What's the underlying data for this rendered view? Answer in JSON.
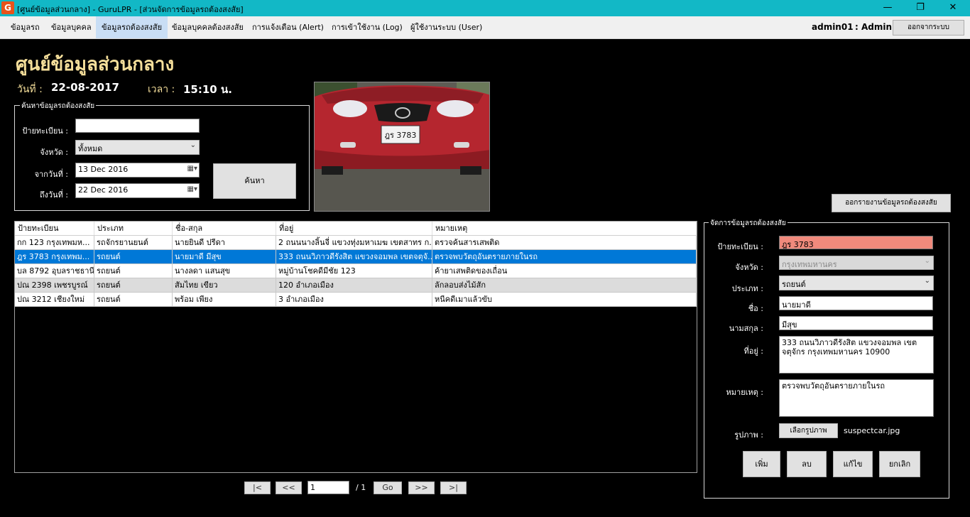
{
  "window": {
    "icon_text": "G",
    "title": "[ศูนย์ข้อมูลส่วนกลาง] - GuruLPR - [ส่วนจัดการข้อมูลรถต้องสงสัย]",
    "minimize": "—",
    "restore": "❐",
    "close": "✕"
  },
  "menu": {
    "items": [
      {
        "label": "ข้อมูลรถ"
      },
      {
        "label": "ข้อมูลบุคคล"
      },
      {
        "label": "ข้อมูลรถต้องสงสัย"
      },
      {
        "label": "ข้อมูลบุคคลต้องสงสัย"
      },
      {
        "label": "การแจ้งเตือน (Alert)"
      },
      {
        "label": "การเข้าใช้งาน (Log)"
      },
      {
        "label": "ผู้ใช้งานระบบ (User)"
      }
    ],
    "active_index": 2,
    "user": "admin01",
    "role": ": Admin",
    "logout": "ออกจากระบบ"
  },
  "header": {
    "title": "ศูนย์ข้อมูลส่วนกลาง",
    "date_label": "วันที่ :",
    "date_value": "22-08-2017",
    "time_label": "เวลา :",
    "time_value": "15:10 น."
  },
  "search": {
    "group_title": "ค้นหาข้อมูลรถต้องสงสัย",
    "plate_label": "ป้ายทะเบียน :",
    "plate_value": "",
    "province_label": "จังหวัด :",
    "province_value": "ทั้งหมด",
    "from_label": "จากวันที่ :",
    "from_value": "13 Dec 2016",
    "to_label": "ถึงวันที่ :",
    "to_value": "22 Dec 2016",
    "search_button": "ค้นหา"
  },
  "photo": {
    "plate_text": "ฎร 3783"
  },
  "report_button": "ออกรายงานข้อมูลรถต้องสงสัย",
  "table": {
    "columns": [
      "ป้ายทะเบียน",
      "ประเภท",
      "ชื่อ-สกุล",
      "ที่อยู่",
      "หมายเหตุ"
    ],
    "rows": [
      {
        "plate": "กก 123 กรุงเทพมห...",
        "type": "รถจักรยานยนต์",
        "name": "นายยินดี ปรีดา",
        "address": "2 ถนนนางลิ้นจี่ แขวงทุ่งมหาเมฆ เขตสาทร ก...",
        "note": "ตรวจค้นสารเสพติด"
      },
      {
        "plate": "ฎร 3783 กรุงเทพม...",
        "type": "รถยนต์",
        "name": "นายมาดี มีสุข",
        "address": "333 ถนนวิภาวดีรังสิต แขวงจอมพล เขตจตุจั...",
        "note": "ตรวจพบวัตถุอันตรายภายในรถ"
      },
      {
        "plate": "บล 8792 อุบลราชธานี",
        "type": "รถยนต์",
        "name": "นางลดา แสนสุข",
        "address": "หมู่บ้านโชคดีมีชัย 123",
        "note": "ค้ายาเสพติดของเถื่อน"
      },
      {
        "plate": "ปณ 2398 เพชรบูรณ์",
        "type": "รถยนต์",
        "name": "สัมไทย เขียว",
        "address": "120 อำเภอเมือง",
        "note": "ลักลอบส่งไม้สัก"
      },
      {
        "plate": "ปณ 3212 เชียงใหม่",
        "type": "รถยนต์",
        "name": "พร้อม เพียง",
        "address": "3 อำเภอเมือง",
        "note": "หนีคดีเมาแล้วขับ"
      }
    ],
    "selected_index": 1
  },
  "pager": {
    "first": "|<",
    "prev": "<<",
    "page_value": "1",
    "total": "/ 1",
    "go": "Go",
    "next": ">>",
    "last": ">|"
  },
  "manage": {
    "group_title": "จัดการข้อมูลรถต้องสงสัย",
    "plate_label": "ป้ายทะเบียน :",
    "plate_value": "ฎร 3783",
    "province_label": "จังหวัด :",
    "province_value": "กรุงเทพมหานคร",
    "type_label": "ประเภท :",
    "type_value": "รถยนต์",
    "firstname_label": "ชื่อ :",
    "firstname_value": "นายมาดี",
    "lastname_label": "นามสกุล :",
    "lastname_value": "มีสุข",
    "address_label": "ที่อยู่ :",
    "address_value": "333 ถนนวิภาวดีรังสิต แขวงจอมพล เขตจตุจักร กรุงเทพมหานคร 10900",
    "note_label": "หมายเหตุ :",
    "note_value": "ตรวจพบวัตถุอันตรายภายในรถ",
    "image_label": "รูปภาพ :",
    "image_button": "เลือกรูปภาพ",
    "image_file": "suspectcar.jpg",
    "add_button": "เพิ่ม",
    "delete_button": "ลบ",
    "edit_button": "แก้ไข",
    "cancel_button": "ยกเลิก"
  },
  "colors": {
    "title_bar": "#12b8c6",
    "heading": "#f4de9a",
    "selected_row": "#0078d7",
    "plate_highlight": "#f08a7c"
  }
}
